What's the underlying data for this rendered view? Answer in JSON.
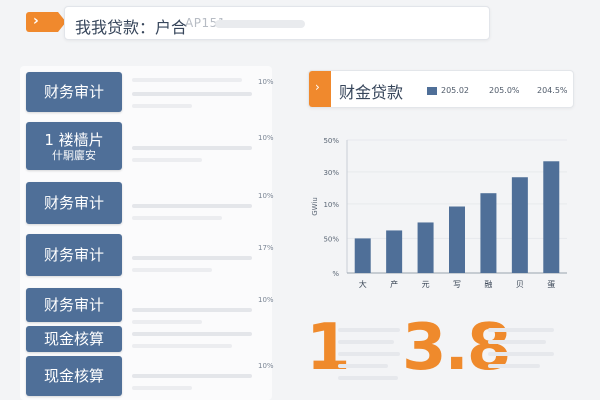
{
  "header": {
    "search_label": "我我贷款：户合",
    "search_ghost": "AP151",
    "menu_glyph": "›"
  },
  "sidebar": {
    "items": [
      {
        "label": "财务审计",
        "sub": "",
        "pct": "10%"
      },
      {
        "label": "1 褛樯片",
        "sub": "什駉廲安",
        "pct": "10%"
      },
      {
        "label": "财务审计",
        "sub": "",
        "pct": "10%"
      },
      {
        "label": "财务审计",
        "sub": "",
        "pct": "17%"
      },
      {
        "label": "财务审计",
        "sub": "",
        "pct": "10%"
      },
      {
        "label": "现金核算",
        "sub": "",
        "pct": ""
      },
      {
        "label": "现金核算",
        "sub": "",
        "pct": "10%"
      }
    ]
  },
  "panel": {
    "title": "财金贷款",
    "tab_glyph": "›",
    "legend": [
      "205.02",
      "205.0%",
      "204.5%"
    ]
  },
  "stats": {
    "left_value": "1",
    "right_value": "3.8"
  },
  "colors": {
    "accent": "#f0892d",
    "button": "#4f6f98",
    "bar": "#4f6f98"
  },
  "chart_data": {
    "type": "bar",
    "categories": [
      "大",
      "产",
      "元",
      "写",
      "融",
      "贝",
      "蛋"
    ],
    "values": [
      13,
      16,
      19,
      25,
      30,
      36,
      42
    ],
    "ylabel": "GWiu",
    "ytick_labels": [
      "50%",
      "30%",
      "10%",
      "50%",
      "%"
    ],
    "ytick_values": [
      50,
      38,
      26,
      13,
      0
    ],
    "ylim": [
      0,
      50
    ],
    "grid": true,
    "legend": "top-right"
  }
}
